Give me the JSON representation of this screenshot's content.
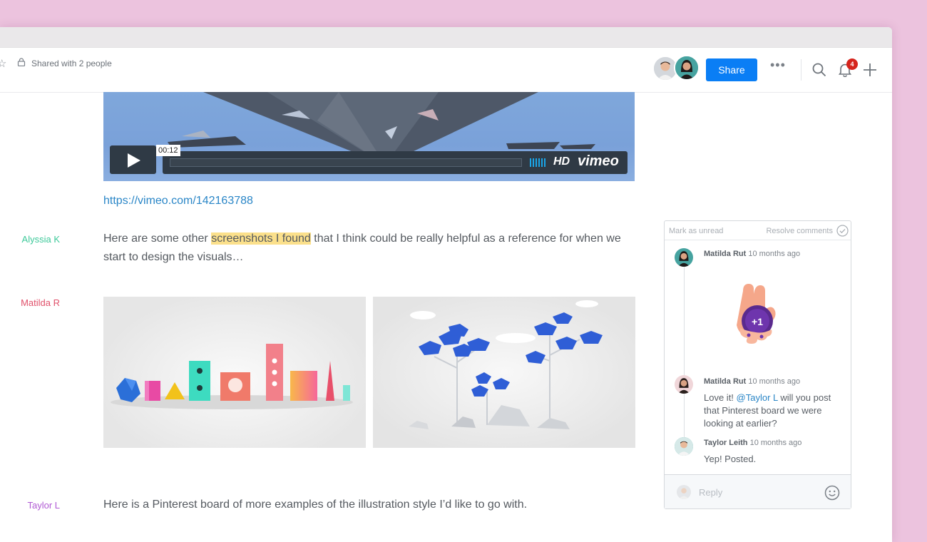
{
  "toolbar": {
    "shared_label": "Shared with 2 people",
    "share_button": "Share",
    "notification_count": "4"
  },
  "video": {
    "time": "00:12",
    "hd_label": "HD",
    "brand": "vimeo",
    "url": "https://vimeo.com/142163788"
  },
  "authors": {
    "a1": "Alyssia K",
    "a2": "Matilda R",
    "a3": "Taylor L"
  },
  "colors": {
    "alyssia": "#3ec99a",
    "matilda": "#e0506a",
    "taylor": "#b05ad4",
    "accent": "#0a7ef5",
    "highlight": "#fbe08b"
  },
  "paragraphs": {
    "p1_before": "Here are some other ",
    "p1_highlight": "screenshots I found",
    "p1_after": " that I think could be really helpful as a reference for when we start to design the visuals…",
    "p2": "Here is a Pinterest board of more examples of the illustration style I’d like to go with."
  },
  "comments_panel": {
    "mark_unread": "Mark as unread",
    "resolve": "Resolve comments",
    "comments": [
      {
        "author": "Matilda Rut",
        "time": "10 months ago",
        "sticker_text": "+1"
      },
      {
        "author": "Matilda Rut",
        "time": "10 months ago",
        "text_before": "Love it! ",
        "mention": "@Taylor L",
        "text_after": " will you post that Pinterest board we were looking at earlier?"
      },
      {
        "author": "Taylor Leith",
        "time": "10 months ago",
        "text": "Yep! Posted."
      }
    ],
    "reply_placeholder": "Reply"
  },
  "icons": [
    "star-icon",
    "lock-icon",
    "more-icon",
    "search-icon",
    "bell-icon",
    "plus-icon",
    "play-icon",
    "check-circle-icon",
    "emoji-icon"
  ]
}
